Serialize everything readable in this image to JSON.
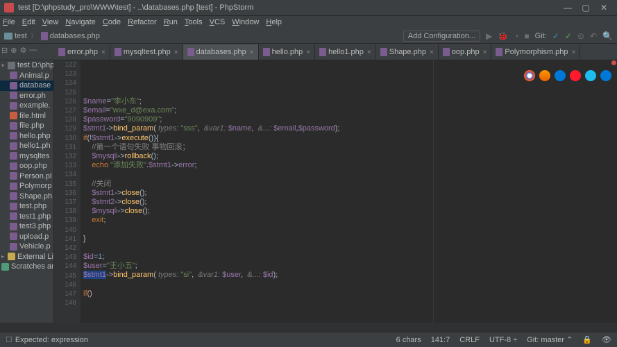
{
  "window_title": "test [D:\\phpstudy_pro\\WWW\\test] - ..\\databases.php [test] - PhpStorm",
  "menu": [
    "File",
    "Edit",
    "View",
    "Navigate",
    "Code",
    "Refactor",
    "Run",
    "Tools",
    "VCS",
    "Window",
    "Help"
  ],
  "nav": {
    "root": "test",
    "file": "databases.php",
    "addcfg": "Add Configuration...",
    "git": "Git:"
  },
  "tabs": [
    {
      "label": "error.php"
    },
    {
      "label": "mysqltest.php"
    },
    {
      "label": "databases.php",
      "active": true
    },
    {
      "label": "hello.php"
    },
    {
      "label": "hello1.php"
    },
    {
      "label": "Shape.php"
    },
    {
      "label": "oop.php"
    },
    {
      "label": "Polymorphism.php"
    }
  ],
  "tree": [
    {
      "type": "folder",
      "label": "test D:\\php",
      "indent": 0,
      "arrow": "▾"
    },
    {
      "type": "php",
      "label": "Animal.p",
      "indent": 1
    },
    {
      "type": "php",
      "label": "database",
      "indent": 1,
      "sel": true
    },
    {
      "type": "php",
      "label": "error.ph",
      "indent": 1
    },
    {
      "type": "php",
      "label": "example.",
      "indent": 1
    },
    {
      "type": "html",
      "label": "file.html",
      "indent": 1
    },
    {
      "type": "php",
      "label": "file.php",
      "indent": 1
    },
    {
      "type": "php",
      "label": "hello.php",
      "indent": 1
    },
    {
      "type": "php",
      "label": "hello1.ph",
      "indent": 1
    },
    {
      "type": "php",
      "label": "mysqltes",
      "indent": 1
    },
    {
      "type": "php",
      "label": "oop.php",
      "indent": 1
    },
    {
      "type": "php",
      "label": "Person.pl",
      "indent": 1
    },
    {
      "type": "php",
      "label": "Polymorp",
      "indent": 1
    },
    {
      "type": "php",
      "label": "Shape.ph",
      "indent": 1
    },
    {
      "type": "php",
      "label": "test.php",
      "indent": 1
    },
    {
      "type": "php",
      "label": "test1.php",
      "indent": 1
    },
    {
      "type": "php",
      "label": "test3.php",
      "indent": 1
    },
    {
      "type": "php",
      "label": "upload.p",
      "indent": 1
    },
    {
      "type": "php",
      "label": "Vehicle.p",
      "indent": 1
    },
    {
      "type": "lib",
      "label": "External Libr",
      "indent": 0,
      "arrow": "▸"
    },
    {
      "type": "scratch",
      "label": "Scratches an",
      "indent": 0
    }
  ],
  "line_start": 122,
  "code_lines": [
    "<span class='c-var'>$name</span>=<span class='c-str'>\"李小东\"</span>;",
    "<span class='c-var'>$email</span>=<span class='c-str'>\"wxe_d@exa.com\"</span>;",
    "<span class='c-var'>$password</span>=<span class='c-str'>\"9090909\"</span>;",
    "<span class='c-var'>$stmt1</span>-&gt;<span class='c-fn'>bind_param</span>( <span class='c-hint'>types:</span> <span class='c-str'>\"sss\"</span>,  <span class='c-hint'>&amp;var1:</span> <span class='c-var'>$name</span>,  <span class='c-hint'>&amp;...:</span> <span class='c-var'>$email</span>,<span class='c-var'>$password</span>);",
    "<span class='c-kw'>if</span>(!<span class='c-var'>$stmt1</span>-&gt;<span class='c-fn'>execute</span>()){",
    "    <span class='c-cm'>//第一个语句失败 事物回滚；</span>",
    "    <span class='c-var'>$mysqli</span>-&gt;<span class='c-fn'>rollback</span>();",
    "    <span class='c-kw'>echo</span> <span class='c-str'>\"添加失败\"</span>.<span class='c-var'>$stmt1</span>-&gt;<span class='c-var'>error</span>;",
    "",
    "    <span class='c-cm'>//关闭</span>",
    "    <span class='c-var'>$stmt1</span>-&gt;<span class='c-fn'>close</span>();",
    "    <span class='c-var'>$stmt2</span>-&gt;<span class='c-fn'>close</span>();",
    "    <span class='c-var'>$mysqli</span>-&gt;<span class='c-fn'>close</span>();",
    "    <span class='c-kw'>exit</span>;",
    "",
    "}",
    "",
    "<span class='c-var'>$id</span>=<span class='c-num'>1</span>;",
    "<span class='c-var'>$user</span>=<span class='c-str'>\"王小五\"</span>;",
    "<span class='hl'><span class='c-var'>$stmt1</span></span>-&gt;<span class='c-fn'>bind_param</span>( <span class='c-hint'>types:</span> <span class='c-str'>\"si\"</span>,  <span class='c-hint'>&amp;var1:</span> <span class='c-var'>$user</span>,  <span class='c-hint'>&amp;...:</span> <span class='c-var'>$id</span>);",
    "",
    "<span class='c-kw'>if</span><span class='c-err'>()</span>",
    "",
    "",
    "",
    "",
    ""
  ],
  "status": {
    "msg": "Expected: expression",
    "chars": "6 chars",
    "pos": "141:7",
    "eol": "CRLF",
    "enc": "UTF-8",
    "git": "Git: master"
  }
}
